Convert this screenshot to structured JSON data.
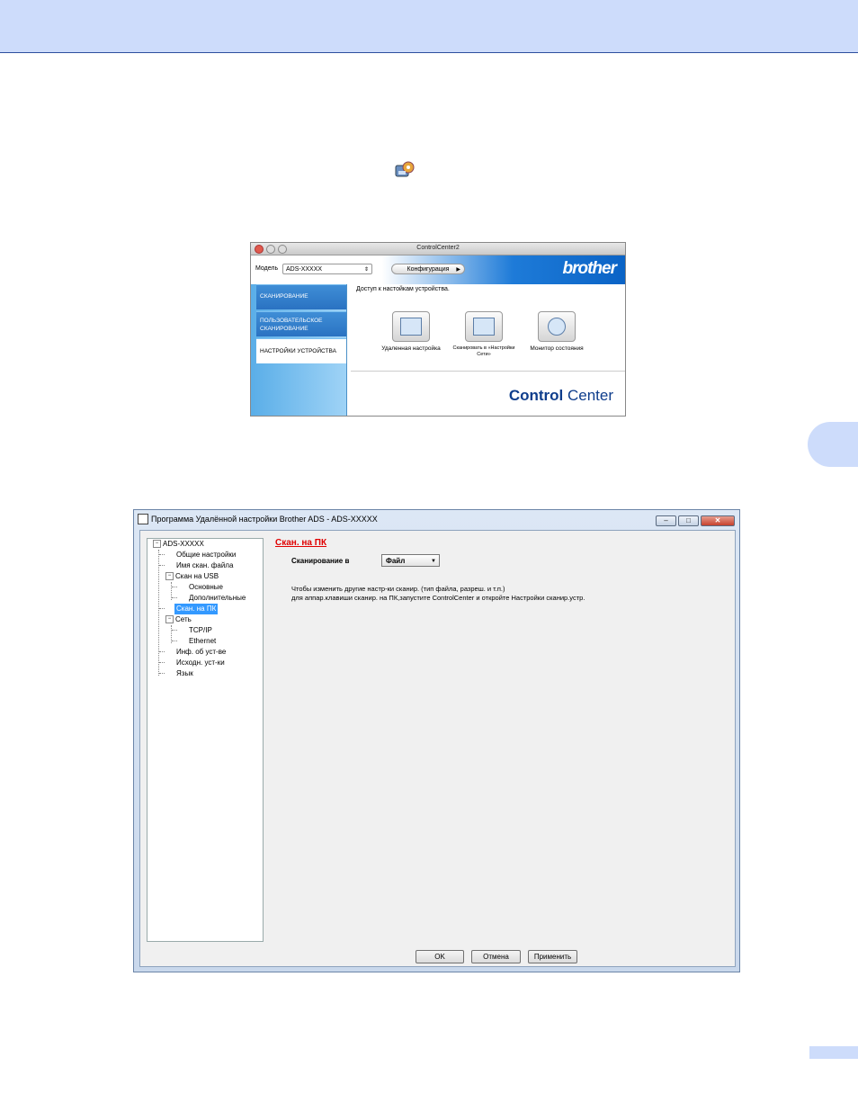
{
  "cc2": {
    "window_title": "ControlCenter2",
    "model_label": "Модель",
    "model_value": "ADS-XXXXX",
    "config_button": "Конфигурация",
    "brand": "brother",
    "tabs": [
      "СКАНИРОВАНИЕ",
      "ПОЛЬЗОВАТЕЛЬСКОЕ СКАНИРОВАНИЕ",
      "НАСТРОЙКИ УСТРОЙСТВА"
    ],
    "access_text": "Доступ к настойкам устройства.",
    "buttons": [
      {
        "label": "Удаленная настройка",
        "icon": "remote-setup-icon"
      },
      {
        "label": "Сканировать в «Настройки Сети»",
        "icon": "scan-network-icon"
      },
      {
        "label": "Монитор состояния",
        "icon": "status-monitor-icon"
      }
    ],
    "logo_bold": "Control",
    "logo_regular": " Center"
  },
  "remote": {
    "window_title": "Программа Удалённой настройки Brother ADS - ADS-XXXXX",
    "tree": {
      "root": "ADS-XXXXX",
      "general": "Общие настройки",
      "file_name": "Имя скан. файла",
      "scan_usb": "Скан на USB",
      "basic": "Основные",
      "advanced": "Дополнительные",
      "scan_pc": "Скан. на ПК",
      "network": "Сеть",
      "tcpip": "TCP/IP",
      "ethernet": "Ethernet",
      "device_info": "Инф. об уст-ве",
      "defaults": "Исходн. уст-ки",
      "language": "Язык"
    },
    "section_title": "Скан. на ПК",
    "scan_to_label": "Сканирование в",
    "scan_to_value": "Файл",
    "info_line1": "Чтобы изменить другие настр-ки сканир. (тип файла, разреш. и т.п.)",
    "info_line2": "для аппар.клавиши сканир. на ПК,запустите ControlCenter и откройте Настройки сканир.устр.",
    "ok": "OK",
    "cancel": "Отмена",
    "apply": "Применить"
  },
  "colors": {
    "band": "#cddcfb",
    "section_title": "#e00000",
    "selection": "#3399ff"
  }
}
